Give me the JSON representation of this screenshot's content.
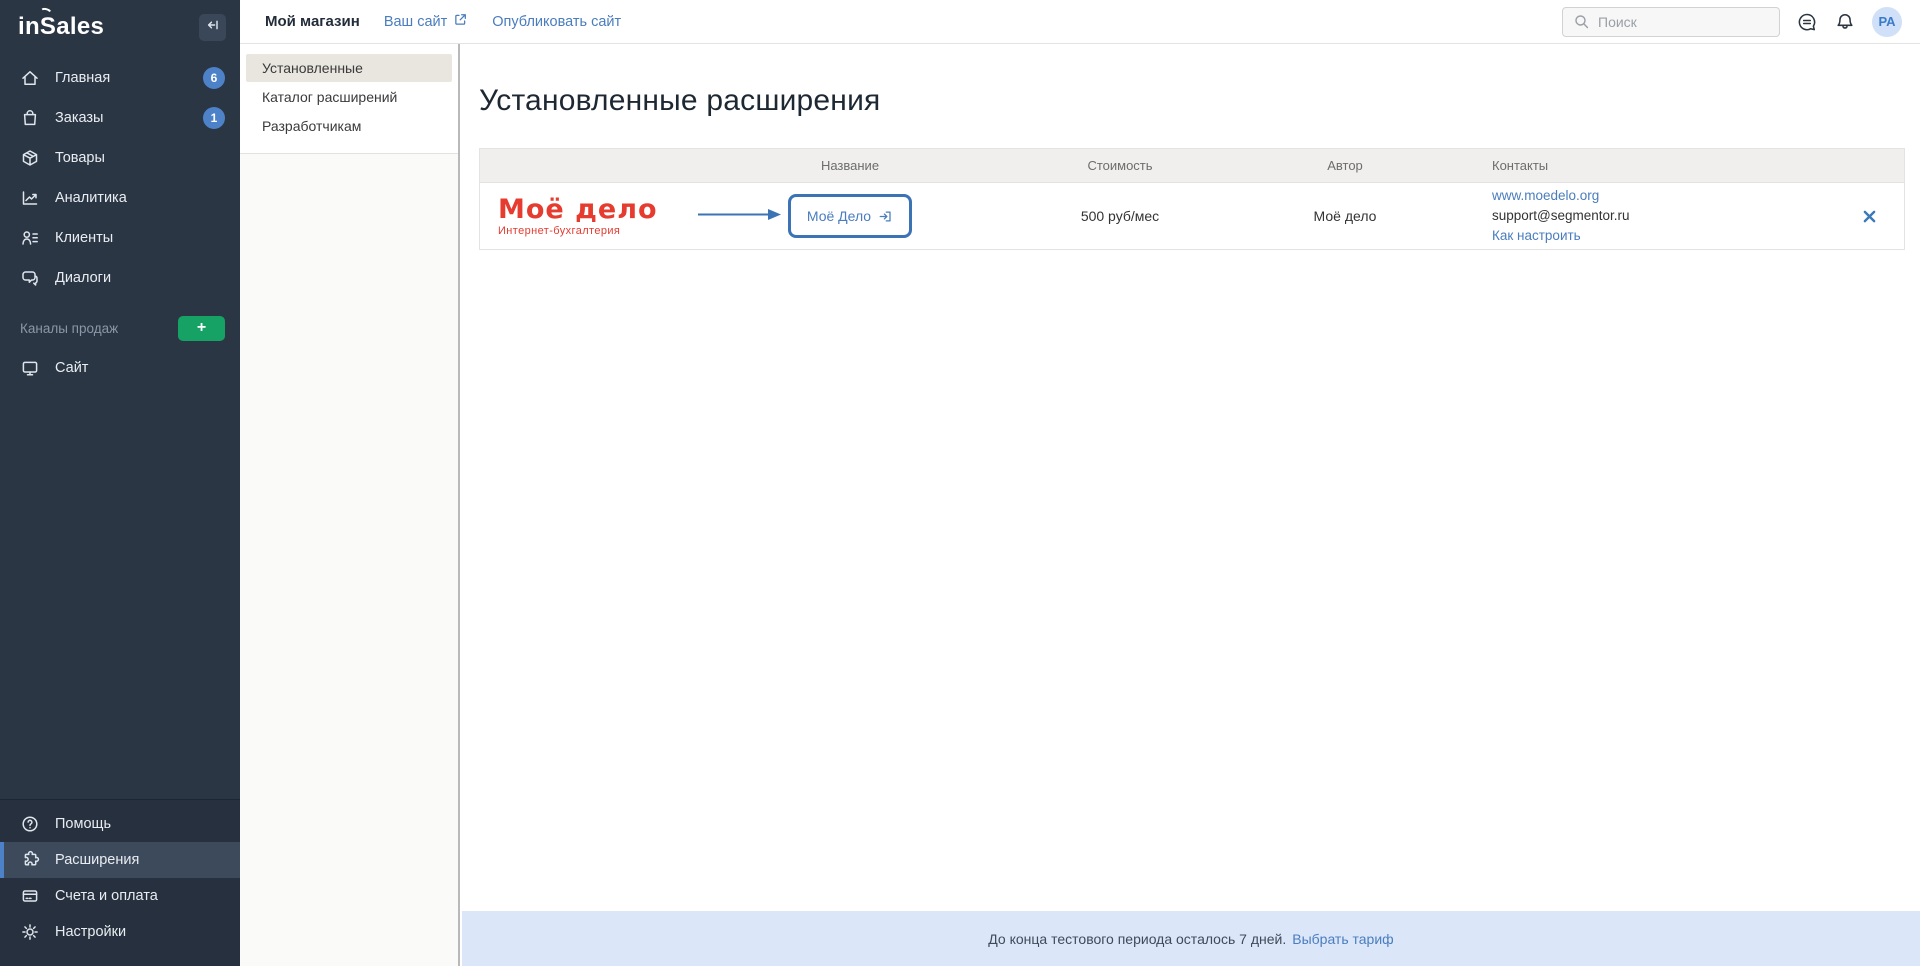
{
  "colors": {
    "accent-blue": "#4a7dbe",
    "annotation-blue": "#3b73b5",
    "brand-red": "#e63b2f",
    "sidebar-bg": "#2b3645",
    "sidebar-active-bg": "#3d4a5c",
    "badge-blue": "#4d82c9",
    "green": "#17a265",
    "banner-bg": "#dbe6f9",
    "avatar-bg": "#cfe0f8"
  },
  "sidebar": {
    "logo": "inSales",
    "nav": [
      {
        "label": "Главная",
        "badge": "6"
      },
      {
        "label": "Заказы",
        "badge": "1"
      },
      {
        "label": "Товары"
      },
      {
        "label": "Аналитика"
      },
      {
        "label": "Клиенты"
      },
      {
        "label": "Диалоги"
      }
    ],
    "section_label": "Каналы продаж",
    "add_button_label": "+",
    "site_label": "Сайт",
    "bottom_nav": [
      {
        "label": "Помощь"
      },
      {
        "label": "Расширения"
      },
      {
        "label": "Счета и оплата"
      },
      {
        "label": "Настройки"
      }
    ]
  },
  "topbar": {
    "store_name": "Мой магазин",
    "your_site_link": "Ваш сайт",
    "publish_link": "Опубликовать сайт",
    "search_placeholder": "Поиск",
    "avatar_initials": "PA"
  },
  "submenu": {
    "items": [
      {
        "label": "Установленные"
      },
      {
        "label": "Каталог расширений"
      },
      {
        "label": "Разработчикам"
      }
    ]
  },
  "main": {
    "title": "Установленные расширения",
    "table": {
      "headers": [
        "Название",
        "Стоимость",
        "Автор",
        "Контакты"
      ],
      "row": {
        "vendor_logo_title": "Моё дело",
        "vendor_logo_subtitle": "Интернет-бухгалтерия",
        "name_link": "Моё Дело",
        "price": "500 руб/мес",
        "author": "Моё дело",
        "contact_site": "www.moedelo.org",
        "contact_email": "support@segmentor.ru",
        "contact_howto": "Как настроить"
      }
    }
  },
  "banner": {
    "text": "До конца тестового периода осталось 7 дней.",
    "link": "Выбрать тариф"
  }
}
